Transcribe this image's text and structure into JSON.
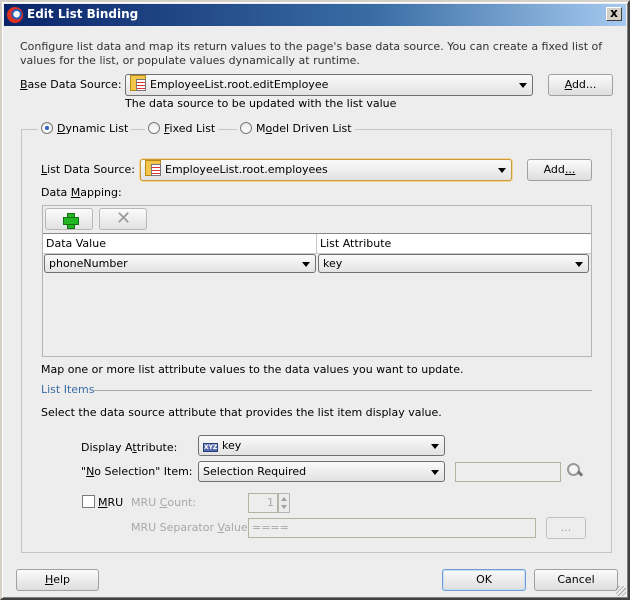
{
  "window": {
    "title": "Edit List Binding",
    "close_label": "x"
  },
  "description": "Configure list data and map its return values to the page's base data source. You can create a fixed list of values for the list, or populate values dynamically at runtime.",
  "base_data_source": {
    "label_prefix": "",
    "label_mnemonic": "B",
    "label_rest": "ase Data Source:",
    "value": "EmployeeList.root.editEmployee",
    "hint": "The data source to be updated with the list value",
    "add_label_mnemonic": "A",
    "add_label_rest": "dd..."
  },
  "list_type": {
    "options": [
      {
        "mnemonic": "D",
        "rest": "ynamic List",
        "checked": true
      },
      {
        "mnemonic": "F",
        "rest": "ixed List",
        "checked": false
      },
      {
        "prefix": "M",
        "mnemonic": "o",
        "rest": "del Driven List",
        "checked": false
      }
    ]
  },
  "list_data_source": {
    "label_mnemonic": "L",
    "label_rest": "ist Data Source:",
    "value": "EmployeeList.root.employees",
    "add_prefix": "Add",
    "add_mnemonic": "...",
    "add_rest": ""
  },
  "data_mapping": {
    "label_prefix": "Data ",
    "label_mnemonic": "M",
    "label_rest": "apping:",
    "add_icon": "plus-icon",
    "remove_icon": "x-icon",
    "columns": [
      "Data Value",
      "List Attribute"
    ],
    "rows": [
      {
        "data_value": "phoneNumber",
        "list_attribute": "key"
      }
    ],
    "hint": "Map one or more list attribute values to the data values you want to update."
  },
  "list_items": {
    "section_title": "List Items",
    "instruction": "Select the data source attribute that provides the list item display value.",
    "display_attribute": {
      "label_prefix": "Display A",
      "label_mnemonic": "t",
      "label_rest": "tribute:",
      "value": "key",
      "icon": "xyz-attribute-icon"
    },
    "no_selection": {
      "label_prefix": "\"",
      "label_mnemonic": "N",
      "label_rest": "o Selection\" Item:",
      "value": "Selection Required",
      "text_value": ""
    },
    "mru": {
      "checkbox_mnemonic": "M",
      "checkbox_rest": "RU",
      "checked": false,
      "count_label_prefix": "MRU ",
      "count_label_mnemonic": "C",
      "count_label_rest": "ount:",
      "count_value": "1",
      "separator_label_prefix": "MRU Separator ",
      "separator_label_mnemonic": "V",
      "separator_label_rest": "alue:",
      "separator_value": "====",
      "browse_label": "..."
    }
  },
  "footer": {
    "help_mnemonic": "H",
    "help_rest": "elp",
    "ok_label": "OK",
    "cancel_label": "Cancel"
  }
}
